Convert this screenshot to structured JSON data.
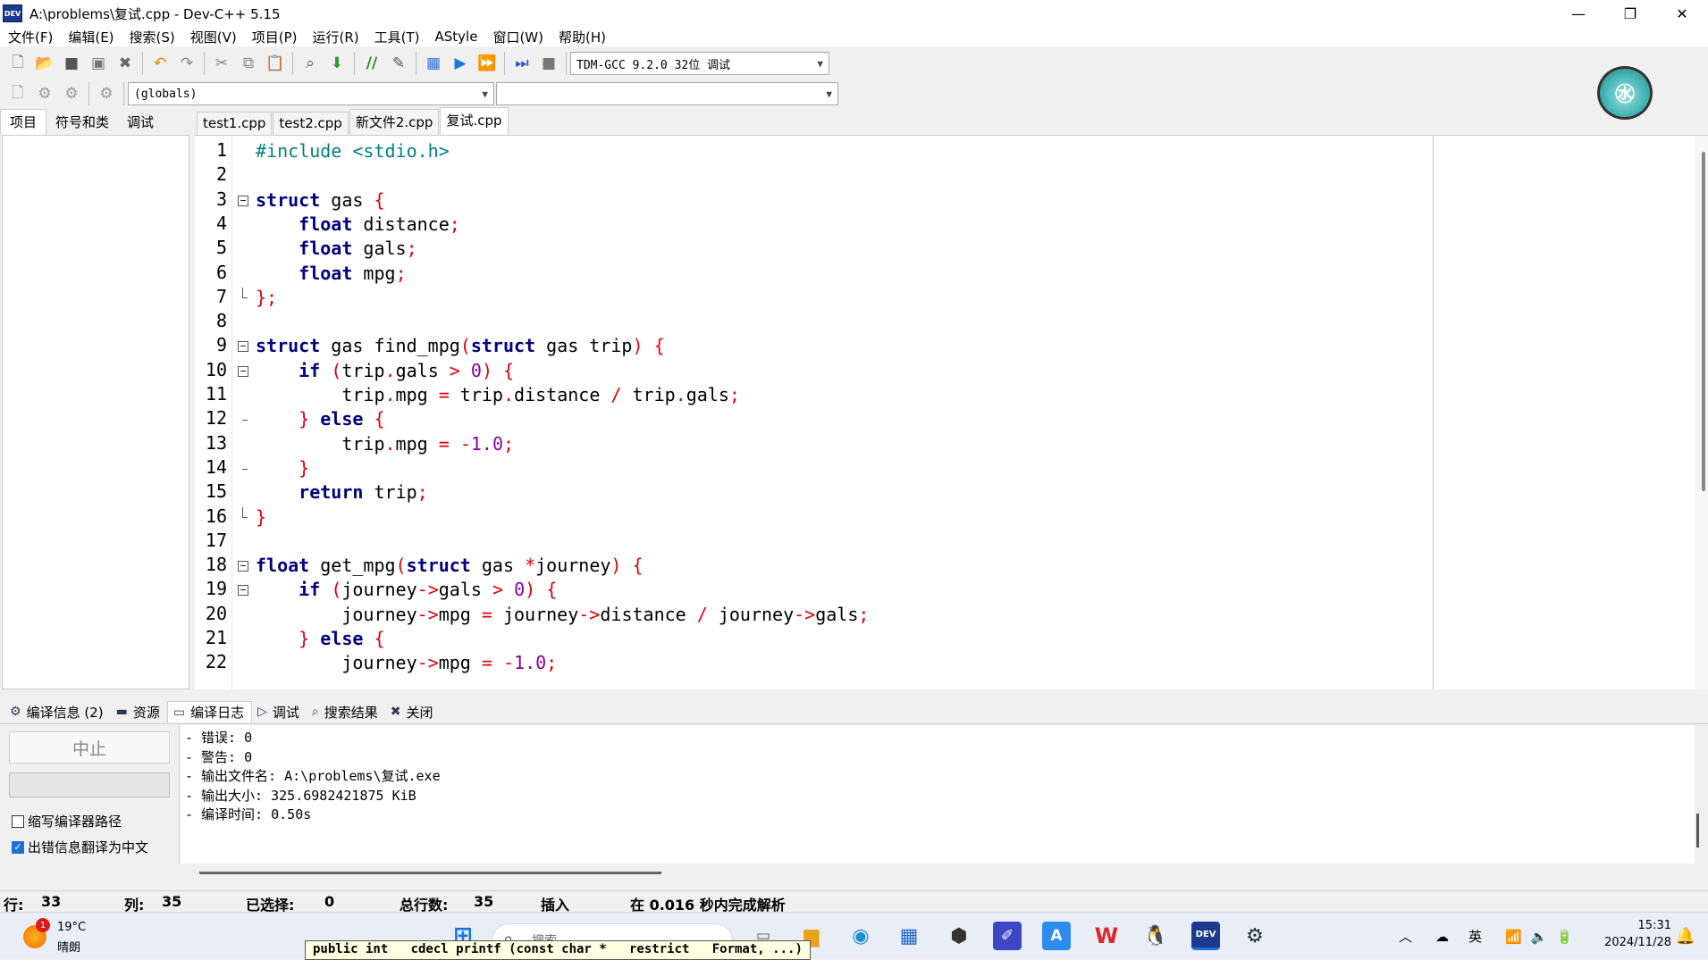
{
  "window": {
    "title": "A:\\problems\\复试.cpp - Dev-C++ 5.15",
    "app_icon": "DEV",
    "controls": {
      "minimize": "—",
      "restore": "❐",
      "close": "✕"
    }
  },
  "menu": [
    "文件(F)",
    "编辑(E)",
    "搜索(S)",
    "视图(V)",
    "项目(P)",
    "运行(R)",
    "工具(T)",
    "AStyle",
    "窗口(W)",
    "帮助(H)"
  ],
  "toolbar": {
    "compiler_select": "TDM-GCC 9.2.0 32位 调试",
    "scope_select": "(globals)",
    "member_select": ""
  },
  "left_tabs": [
    "项目",
    "符号和类",
    "调试"
  ],
  "file_tabs": [
    "test1.cpp",
    "test2.cpp",
    "新文件2.cpp",
    "复试.cpp"
  ],
  "active_file_tab": 3,
  "editor": {
    "line_numbers": [
      "1",
      "2",
      "3",
      "4",
      "5",
      "6",
      "7",
      "8",
      "9",
      "10",
      "11",
      "12",
      "13",
      "14",
      "15",
      "16",
      "17",
      "18",
      "19",
      "20",
      "21",
      "22"
    ],
    "lines": [
      "#include <stdio.h>",
      "",
      "struct gas {",
      "    float distance;",
      "    float gals;",
      "    float mpg;",
      "};",
      "",
      "struct gas find_mpg(struct gas trip) {",
      "    if (trip.gals > 0) {",
      "        trip.mpg = trip.distance / trip.gals;",
      "    } else {",
      "        trip.mpg = -1.0;",
      "    }",
      "    return trip;",
      "}",
      "",
      "float get_mpg(struct gas *journey) {",
      "    if (journey->gals > 0) {",
      "        journey->mpg = journey->distance / journey->gals;",
      "    } else {",
      "        journey->mpg = -1.0;"
    ]
  },
  "bottom_tabs": [
    {
      "icon": "compile-info-icon",
      "glyph": "⚙",
      "label": "编译信息 (2)"
    },
    {
      "icon": "resources-icon",
      "glyph": "▬",
      "label": "资源"
    },
    {
      "icon": "compile-log-icon",
      "glyph": "▭",
      "label": "编译日志"
    },
    {
      "icon": "debug-icon",
      "glyph": "▷",
      "label": "调试"
    },
    {
      "icon": "search-results-icon",
      "glyph": "⌕",
      "label": "搜索结果"
    },
    {
      "icon": "close-icon",
      "glyph": "✖",
      "label": "关闭"
    }
  ],
  "compile_panel": {
    "stop_label": "中止",
    "shorten_paths_label": "缩写编译器路径",
    "shorten_paths_checked": false,
    "translate_label": "出错信息翻译为中文",
    "translate_checked": true,
    "log_lines": [
      "- 错误: 0",
      "- 警告: 0",
      "- 输出文件名: A:\\problems\\复试.exe",
      "- 输出大小: 325.6982421875 KiB",
      "- 编译时间: 0.50s"
    ]
  },
  "statusbar": {
    "row_label": "行:",
    "row": "33",
    "col_label": "列:",
    "col": "35",
    "selected_label": "已选择:",
    "selected": "0",
    "total_label": "总行数:",
    "total": "35",
    "mode": "插入",
    "parse_msg": "在 0.016 秒内完成解析"
  },
  "tooltip": "public int   cdecl printf (const char *   restrict   Format, ...)",
  "taskbar": {
    "weather_badge": "1",
    "temperature": "19°C",
    "condition": "晴朗",
    "search_placeholder": "搜索",
    "tray_lang": "英",
    "time": "15:31",
    "date": "2024/11/28"
  },
  "colors": {
    "keyword": "#00007f",
    "symbol": "#e0000e",
    "number": "#8800a0",
    "preprocessor": "#008080"
  }
}
